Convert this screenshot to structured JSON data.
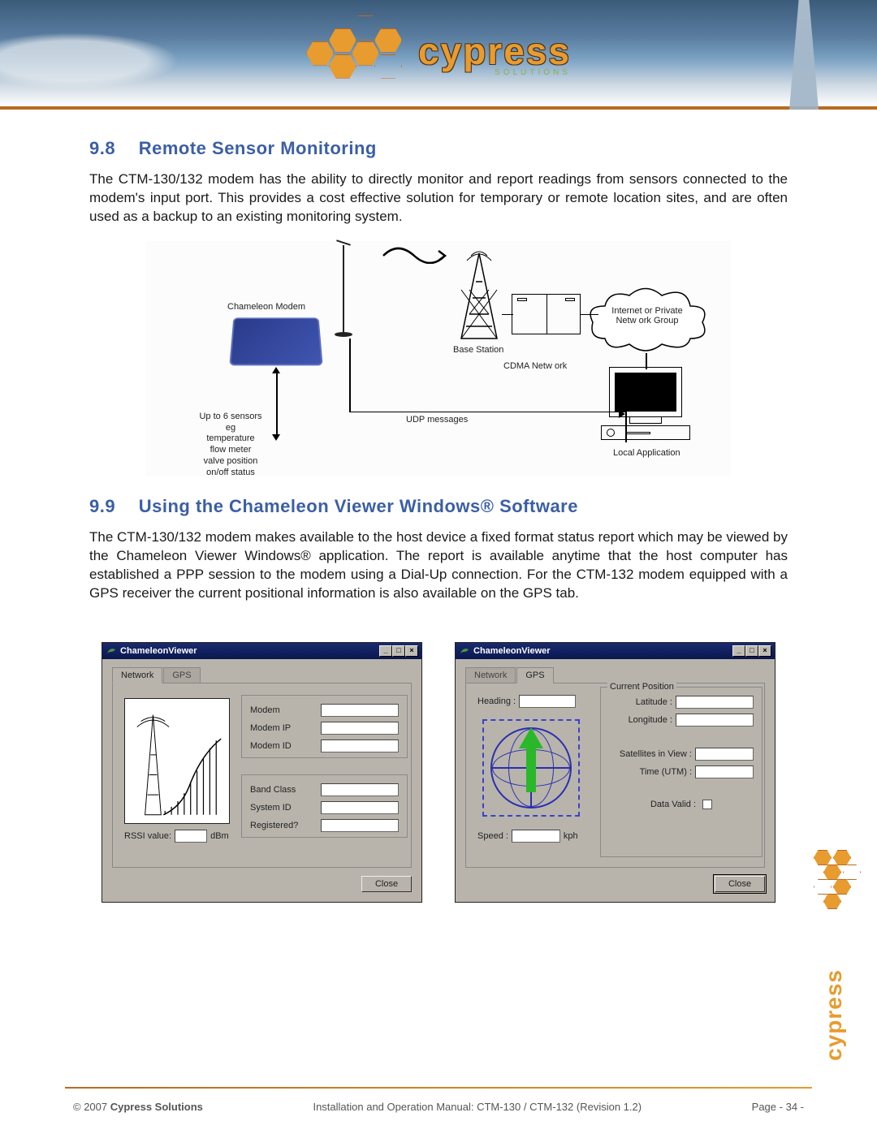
{
  "header": {
    "brand": "cypress",
    "brand_sub": "SOLUTIONS"
  },
  "section_98": {
    "number": "9.8",
    "title": "Remote Sensor Monitoring",
    "paragraph": "The CTM-130/132 modem has the ability to directly monitor and report readings from sensors connected to the modem's input port. This provides a cost effective solution for temporary or remote location sites, and are often used as a backup to an existing monitoring system."
  },
  "diagram": {
    "modem_label": "Chameleon Modem",
    "sensors_label": "Up to 6 sensors\neg\ntemperature\nflow meter\nvalve position\non/off status",
    "base_station": "Base Station",
    "cdma": "CDMA Netw ork",
    "udp": "UDP messages",
    "cloud": "Internet or Private\nNetw ork Group",
    "local_app": "Local Application"
  },
  "section_99": {
    "number": "9.9",
    "title": "Using the Chameleon Viewer Windows® Software",
    "paragraph": "The CTM-130/132 modem makes available to the host device a fixed format status report which may be viewed by the Chameleon Viewer Windows® application. The report is available anytime that the host computer has established a PPP session to the modem using a Dial-Up connection. For the CTM-132 modem equipped with a GPS receiver the current positional information is also available on the GPS tab."
  },
  "app": {
    "title": "ChameleonViewer",
    "tabs": {
      "network": "Network",
      "gps": "GPS"
    },
    "close": "Close",
    "network_panel": {
      "modem": "Modem",
      "modem_ip": "Modem IP",
      "modem_id": "Modem ID",
      "band_class": "Band Class",
      "system_id": "System ID",
      "registered": "Registered?",
      "rssi_label": "RSSI value:",
      "rssi_unit": "dBm"
    },
    "gps_panel": {
      "heading": "Heading :",
      "speed": "Speed :",
      "speed_unit": "kph",
      "group_title": "Current Position",
      "latitude": "Latitude :",
      "longitude": "Longitude :",
      "sat": "Satellites in View :",
      "time": "Time (UTM) :",
      "data_valid": "Data Valid :"
    }
  },
  "footer": {
    "copyright": "© 2007 Cypress Solutions",
    "center": "Installation and Operation Manual: CTM-130 / CTM-132 (Revision 1.2)",
    "page_prefix": "Page",
    "page_no": "- 34 -"
  }
}
